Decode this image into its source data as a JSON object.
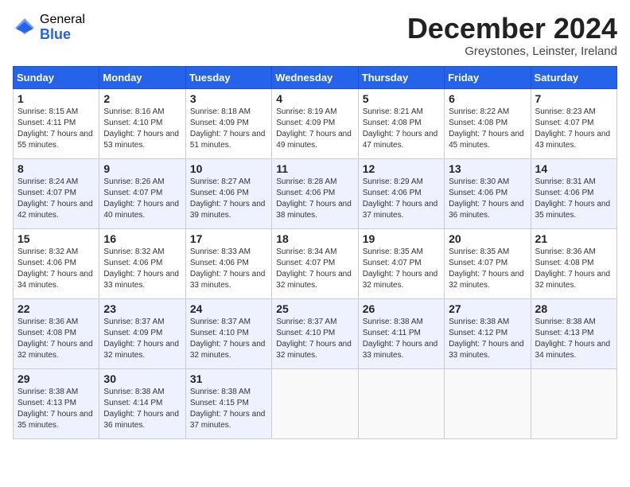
{
  "logo": {
    "general": "General",
    "blue": "Blue"
  },
  "title": "December 2024",
  "subtitle": "Greystones, Leinster, Ireland",
  "days_of_week": [
    "Sunday",
    "Monday",
    "Tuesday",
    "Wednesday",
    "Thursday",
    "Friday",
    "Saturday"
  ],
  "weeks": [
    [
      {
        "day": "1",
        "sunrise": "Sunrise: 8:15 AM",
        "sunset": "Sunset: 4:11 PM",
        "daylight": "Daylight: 7 hours and 55 minutes."
      },
      {
        "day": "2",
        "sunrise": "Sunrise: 8:16 AM",
        "sunset": "Sunset: 4:10 PM",
        "daylight": "Daylight: 7 hours and 53 minutes."
      },
      {
        "day": "3",
        "sunrise": "Sunrise: 8:18 AM",
        "sunset": "Sunset: 4:09 PM",
        "daylight": "Daylight: 7 hours and 51 minutes."
      },
      {
        "day": "4",
        "sunrise": "Sunrise: 8:19 AM",
        "sunset": "Sunset: 4:09 PM",
        "daylight": "Daylight: 7 hours and 49 minutes."
      },
      {
        "day": "5",
        "sunrise": "Sunrise: 8:21 AM",
        "sunset": "Sunset: 4:08 PM",
        "daylight": "Daylight: 7 hours and 47 minutes."
      },
      {
        "day": "6",
        "sunrise": "Sunrise: 8:22 AM",
        "sunset": "Sunset: 4:08 PM",
        "daylight": "Daylight: 7 hours and 45 minutes."
      },
      {
        "day": "7",
        "sunrise": "Sunrise: 8:23 AM",
        "sunset": "Sunset: 4:07 PM",
        "daylight": "Daylight: 7 hours and 43 minutes."
      }
    ],
    [
      {
        "day": "8",
        "sunrise": "Sunrise: 8:24 AM",
        "sunset": "Sunset: 4:07 PM",
        "daylight": "Daylight: 7 hours and 42 minutes."
      },
      {
        "day": "9",
        "sunrise": "Sunrise: 8:26 AM",
        "sunset": "Sunset: 4:07 PM",
        "daylight": "Daylight: 7 hours and 40 minutes."
      },
      {
        "day": "10",
        "sunrise": "Sunrise: 8:27 AM",
        "sunset": "Sunset: 4:06 PM",
        "daylight": "Daylight: 7 hours and 39 minutes."
      },
      {
        "day": "11",
        "sunrise": "Sunrise: 8:28 AM",
        "sunset": "Sunset: 4:06 PM",
        "daylight": "Daylight: 7 hours and 38 minutes."
      },
      {
        "day": "12",
        "sunrise": "Sunrise: 8:29 AM",
        "sunset": "Sunset: 4:06 PM",
        "daylight": "Daylight: 7 hours and 37 minutes."
      },
      {
        "day": "13",
        "sunrise": "Sunrise: 8:30 AM",
        "sunset": "Sunset: 4:06 PM",
        "daylight": "Daylight: 7 hours and 36 minutes."
      },
      {
        "day": "14",
        "sunrise": "Sunrise: 8:31 AM",
        "sunset": "Sunset: 4:06 PM",
        "daylight": "Daylight: 7 hours and 35 minutes."
      }
    ],
    [
      {
        "day": "15",
        "sunrise": "Sunrise: 8:32 AM",
        "sunset": "Sunset: 4:06 PM",
        "daylight": "Daylight: 7 hours and 34 minutes."
      },
      {
        "day": "16",
        "sunrise": "Sunrise: 8:32 AM",
        "sunset": "Sunset: 4:06 PM",
        "daylight": "Daylight: 7 hours and 33 minutes."
      },
      {
        "day": "17",
        "sunrise": "Sunrise: 8:33 AM",
        "sunset": "Sunset: 4:06 PM",
        "daylight": "Daylight: 7 hours and 33 minutes."
      },
      {
        "day": "18",
        "sunrise": "Sunrise: 8:34 AM",
        "sunset": "Sunset: 4:07 PM",
        "daylight": "Daylight: 7 hours and 32 minutes."
      },
      {
        "day": "19",
        "sunrise": "Sunrise: 8:35 AM",
        "sunset": "Sunset: 4:07 PM",
        "daylight": "Daylight: 7 hours and 32 minutes."
      },
      {
        "day": "20",
        "sunrise": "Sunrise: 8:35 AM",
        "sunset": "Sunset: 4:07 PM",
        "daylight": "Daylight: 7 hours and 32 minutes."
      },
      {
        "day": "21",
        "sunrise": "Sunrise: 8:36 AM",
        "sunset": "Sunset: 4:08 PM",
        "daylight": "Daylight: 7 hours and 32 minutes."
      }
    ],
    [
      {
        "day": "22",
        "sunrise": "Sunrise: 8:36 AM",
        "sunset": "Sunset: 4:08 PM",
        "daylight": "Daylight: 7 hours and 32 minutes."
      },
      {
        "day": "23",
        "sunrise": "Sunrise: 8:37 AM",
        "sunset": "Sunset: 4:09 PM",
        "daylight": "Daylight: 7 hours and 32 minutes."
      },
      {
        "day": "24",
        "sunrise": "Sunrise: 8:37 AM",
        "sunset": "Sunset: 4:10 PM",
        "daylight": "Daylight: 7 hours and 32 minutes."
      },
      {
        "day": "25",
        "sunrise": "Sunrise: 8:37 AM",
        "sunset": "Sunset: 4:10 PM",
        "daylight": "Daylight: 7 hours and 32 minutes."
      },
      {
        "day": "26",
        "sunrise": "Sunrise: 8:38 AM",
        "sunset": "Sunset: 4:11 PM",
        "daylight": "Daylight: 7 hours and 33 minutes."
      },
      {
        "day": "27",
        "sunrise": "Sunrise: 8:38 AM",
        "sunset": "Sunset: 4:12 PM",
        "daylight": "Daylight: 7 hours and 33 minutes."
      },
      {
        "day": "28",
        "sunrise": "Sunrise: 8:38 AM",
        "sunset": "Sunset: 4:13 PM",
        "daylight": "Daylight: 7 hours and 34 minutes."
      }
    ],
    [
      {
        "day": "29",
        "sunrise": "Sunrise: 8:38 AM",
        "sunset": "Sunset: 4:13 PM",
        "daylight": "Daylight: 7 hours and 35 minutes."
      },
      {
        "day": "30",
        "sunrise": "Sunrise: 8:38 AM",
        "sunset": "Sunset: 4:14 PM",
        "daylight": "Daylight: 7 hours and 36 minutes."
      },
      {
        "day": "31",
        "sunrise": "Sunrise: 8:38 AM",
        "sunset": "Sunset: 4:15 PM",
        "daylight": "Daylight: 7 hours and 37 minutes."
      },
      null,
      null,
      null,
      null
    ]
  ]
}
